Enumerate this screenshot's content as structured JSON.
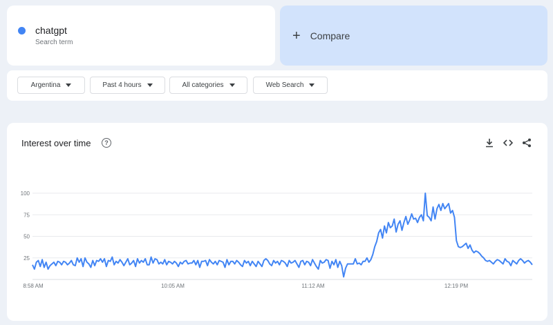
{
  "search_term": {
    "name": "chatgpt",
    "subtitle": "Search term",
    "color": "#4285f4"
  },
  "compare": {
    "label": "Compare"
  },
  "filters": [
    {
      "label": "Argentina"
    },
    {
      "label": "Past 4 hours"
    },
    {
      "label": "All categories"
    },
    {
      "label": "Web Search"
    }
  ],
  "chart_card": {
    "title": "Interest over time",
    "help_icon": "question-icon",
    "tools": [
      "download-icon",
      "embed-code-icon",
      "share-icon"
    ]
  },
  "chart_data": {
    "type": "line",
    "title": "Interest over time",
    "ylim": [
      0,
      100
    ],
    "y_ticks": [
      "25",
      "50",
      "75",
      "100"
    ],
    "y_tick_values": [
      25,
      50,
      75,
      100
    ],
    "x_tick_labels": [
      "8:58 AM",
      "10:05 AM",
      "11:12 AM",
      "12:19 PM"
    ],
    "grid": true,
    "series": [
      {
        "color": "#4285f4",
        "values": [
          17,
          12,
          20,
          22,
          15,
          23,
          14,
          20,
          12,
          16,
          18,
          20,
          16,
          21,
          20,
          17,
          21,
          20,
          17,
          19,
          22,
          17,
          16,
          25,
          20,
          24,
          15,
          25,
          20,
          18,
          14,
          22,
          16,
          22,
          21,
          24,
          20,
          24,
          15,
          22,
          21,
          26,
          17,
          21,
          19,
          23,
          20,
          16,
          20,
          24,
          17,
          19,
          22,
          15,
          24,
          19,
          22,
          20,
          24,
          17,
          17,
          26,
          19,
          24,
          23,
          18,
          20,
          18,
          23,
          17,
          21,
          20,
          18,
          21,
          19,
          15,
          20,
          18,
          21,
          22,
          18,
          19,
          19,
          22,
          17,
          22,
          14,
          21,
          21,
          22,
          16,
          23,
          20,
          18,
          21,
          17,
          22,
          21,
          20,
          14,
          23,
          17,
          21,
          21,
          18,
          22,
          20,
          17,
          15,
          22,
          19,
          21,
          16,
          21,
          18,
          15,
          21,
          18,
          15,
          22,
          24,
          22,
          18,
          16,
          22,
          19,
          21,
          17,
          22,
          21,
          19,
          15,
          22,
          19,
          20,
          22,
          18,
          14,
          21,
          22,
          17,
          21,
          20,
          16,
          23,
          19,
          15,
          12,
          22,
          19,
          20,
          23,
          22,
          13,
          21,
          17,
          23,
          14,
          21,
          16,
          3,
          13,
          18,
          18,
          18,
          18,
          24,
          18,
          19,
          17,
          21,
          21,
          25,
          20,
          23,
          29,
          38,
          44,
          54,
          58,
          48,
          62,
          54,
          66,
          60,
          62,
          70,
          55,
          64,
          68,
          57,
          66,
          73,
          64,
          69,
          76,
          70,
          71,
          66,
          72,
          75,
          68,
          100,
          74,
          72,
          68,
          84,
          70,
          82,
          87,
          80,
          88,
          82,
          85,
          88,
          77,
          80,
          72,
          45,
          38,
          37,
          38,
          40,
          42,
          36,
          40,
          34,
          31,
          33,
          32,
          30,
          27,
          25,
          22,
          21,
          22,
          20,
          18,
          21,
          23,
          22,
          20,
          18,
          24,
          21,
          20,
          16,
          22,
          20,
          18,
          22,
          24,
          22,
          19,
          21,
          22,
          20,
          17
        ]
      }
    ]
  }
}
